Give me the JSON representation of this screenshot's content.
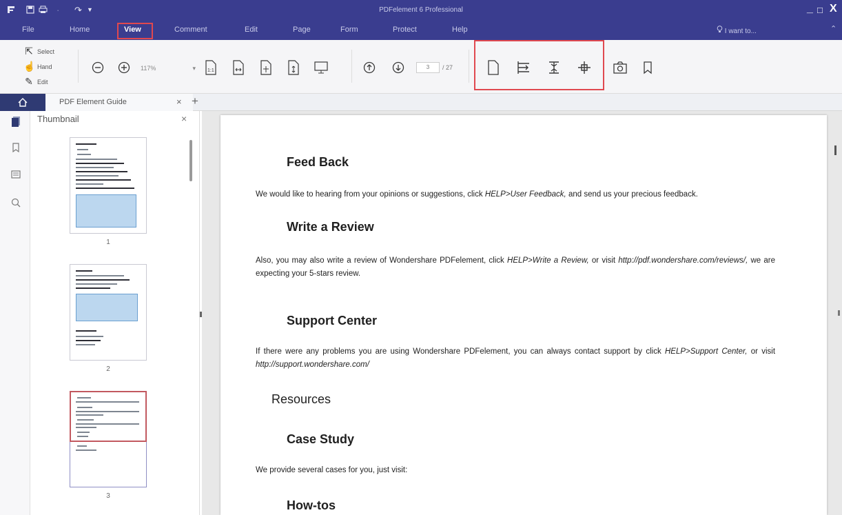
{
  "app": {
    "title": "PDFelement 6 Professional",
    "window_controls": [
      "_",
      "□",
      "X"
    ]
  },
  "quick_access": {
    "logo_icon": "pdfelement-logo-icon",
    "save_icon": "save-icon",
    "print_icon": "print-icon",
    "redo_icon": "redo-icon",
    "customize_icon": "dropdown-icon"
  },
  "menu": {
    "items": [
      "File",
      "Home",
      "View",
      "Comment",
      "Edit",
      "Page",
      "Form",
      "Protect",
      "Help"
    ],
    "active": "View",
    "help_search": "I want to...",
    "collapse_icon": "chevron-up-icon"
  },
  "ribbon": {
    "modes": {
      "select": "Select",
      "hand": "Hand",
      "edit": "Edit"
    },
    "zoom_value": "117%",
    "page_current": "3",
    "page_total": "/  27",
    "highlight_color": "#e0484f",
    "view_tools": [
      "single-page-icon",
      "split-vertical-icon",
      "split-horizontal-icon",
      "split-four-icon"
    ]
  },
  "tabs": {
    "doc_title": "PDF Element Guide",
    "close": "×",
    "new_tab": "+"
  },
  "thumbnail_panel": {
    "title": "Thumbnail",
    "close": "×",
    "pages": [
      "1",
      "2",
      "3"
    ]
  },
  "document": {
    "feedback_heading": "Feed Back",
    "feedback_text_1": "We would like to hearing from your opinions or suggestions, click ",
    "feedback_link": "HELP>User Feedback,",
    "feedback_text_2": " and send us your precious feedback.",
    "review_heading": "Write a Review",
    "review_text_1": "Also, you may also write a review of Wondershare PDFelement, click ",
    "review_link": "HELP>Write a Review,",
    "review_text_2": " or visit ",
    "review_url": "http://pdf.wondershare.com/reviews/,",
    "review_text_3": " we are expecting your 5-stars review.",
    "support_heading": "Support Center",
    "support_text_1": "If there were any problems you are using Wondershare PDFelement, you can always contact support by click ",
    "support_link": "HELP>Support Center,",
    "support_text_2": " or visit ",
    "support_url": "http://support.wondershare.com/",
    "resources_heading": "Resources",
    "case_heading": "Case Study",
    "case_text": "We provide several cases for you, just visit:",
    "howtos_heading": "How-tos"
  },
  "colors": {
    "titlebar": "#3a3d8f",
    "tab_home": "#2f3a73",
    "highlight": "#e0484f"
  }
}
